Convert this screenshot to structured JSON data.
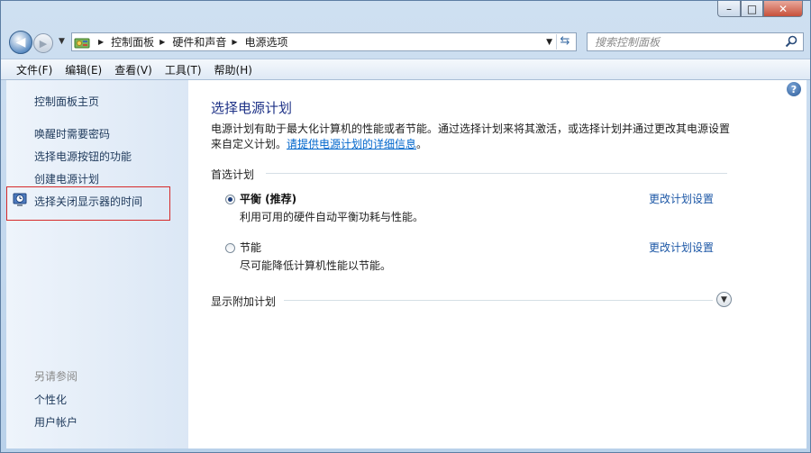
{
  "window": {
    "minimize_label": "–",
    "maximize_label": "□",
    "close_label": "✕"
  },
  "address": {
    "breadcrumbs": [
      "控制面板",
      "硬件和声音",
      "电源选项"
    ],
    "search_placeholder": "搜索控制面板"
  },
  "menu": {
    "items": [
      "文件(F)",
      "编辑(E)",
      "查看(V)",
      "工具(T)",
      "帮助(H)"
    ]
  },
  "sidebar": {
    "home": "控制面板主页",
    "tasks": [
      "唤醒时需要密码",
      "选择电源按钮的功能",
      "创建电源计划",
      "选择关闭显示器的时间"
    ],
    "see_also_title": "另请参阅",
    "see_also": [
      "个性化",
      "用户帐户"
    ]
  },
  "main": {
    "title": "选择电源计划",
    "intro_line1": "电源计划有助于最大化计算机的性能或者节能。通过选择计划来将其激活，或选择计划并通过更改其电源设置",
    "intro_line2_prefix": "来自定义计划。",
    "intro_link": "请提供电源计划的详细信息",
    "intro_suffix": "。",
    "preferred_label": "首选计划",
    "plans": [
      {
        "name": "平衡 (推荐)",
        "desc": "利用可用的硬件自动平衡功耗与性能。",
        "link": "更改计划设置",
        "checked": true
      },
      {
        "name": "节能",
        "desc": "尽可能降低计算机性能以节能。",
        "link": "更改计划设置",
        "checked": false
      }
    ],
    "more_plans_label": "显示附加计划",
    "help_label": "?"
  }
}
